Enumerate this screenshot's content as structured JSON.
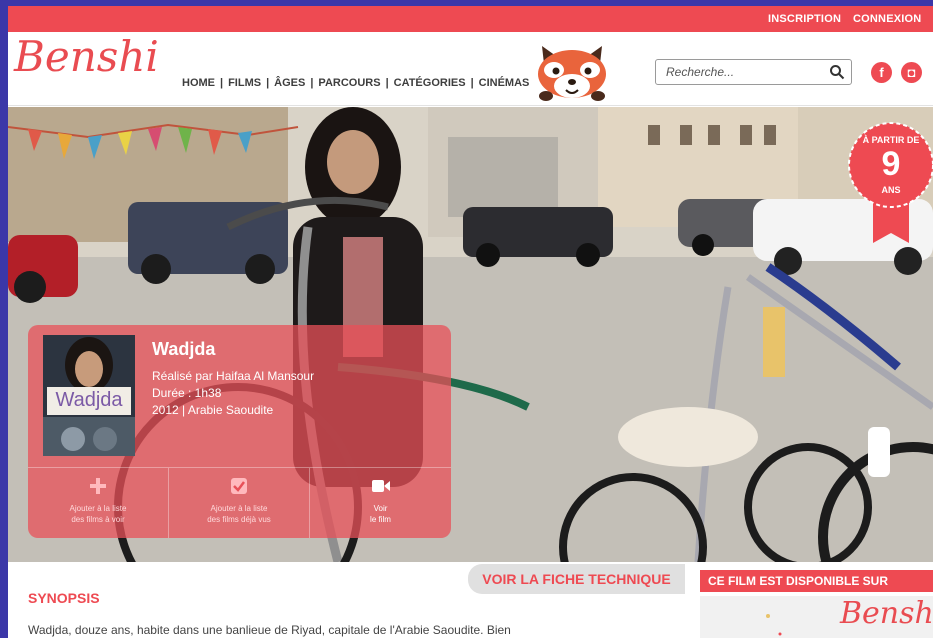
{
  "colors": {
    "accent": "#ee4a52",
    "background": "#3b37a8",
    "card": "rgba(232,80,88,0.75)"
  },
  "topbar": {
    "signup_label": "INSCRIPTION",
    "login_label": "CONNEXION"
  },
  "header": {
    "logo": "Benshi",
    "nav": [
      {
        "label": "HOME"
      },
      {
        "label": "FILMS"
      },
      {
        "label": "ÂGES"
      },
      {
        "label": "PARCOURS"
      },
      {
        "label": "CATÉGORIES"
      },
      {
        "label": "CINÉMAS"
      }
    ],
    "search": {
      "placeholder": "Recherche..."
    },
    "social": [
      {
        "icon": "facebook-icon",
        "glyph": "f"
      },
      {
        "icon": "instagram-icon",
        "glyph": "◘"
      }
    ]
  },
  "hero": {
    "age_badge": {
      "line1": "À PARTIR DE",
      "age": "9",
      "line2": "ANS"
    },
    "film": {
      "title": "Wadjda",
      "poster_title": "Wadjda",
      "director": "Réalisé par Haifaa Al Mansour",
      "duration": "Durée : 1h38",
      "year_country": "2012 | Arabie Saoudite"
    },
    "actions": [
      {
        "icon": "plus-icon",
        "line1": "Ajouter à la liste",
        "line2": "des films à voir"
      },
      {
        "icon": "checkbox-icon",
        "line1": "Ajouter à la liste",
        "line2": "des films déjà vus"
      },
      {
        "icon": "video-camera-icon",
        "line1": "Voir",
        "line2": "le film"
      }
    ]
  },
  "content": {
    "fiche_button": "VOIR LA FICHE TECHNIQUE",
    "synopsis_title": "SYNOPSIS",
    "synopsis_text": "Wadjda, douze ans, habite dans une banlieue de Riyad, capitale de l'Arabie Saoudite. Bien"
  },
  "sidebar": {
    "available_title": "CE FILM EST DISPONIBLE SUR",
    "available_logo": "Benshi"
  }
}
